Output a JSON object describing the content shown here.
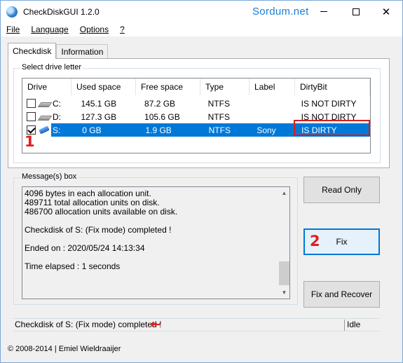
{
  "window": {
    "title": "CheckDiskGUI 1.2.0",
    "watermark": "Sordum.net",
    "close_glyph": "✕"
  },
  "menu": {
    "items": [
      "File",
      "Language",
      "Options",
      "?"
    ]
  },
  "tabs": [
    {
      "label": "Checkdisk",
      "active": true
    },
    {
      "label": "Information",
      "active": false
    }
  ],
  "drive_group": {
    "label": "Select drive letter",
    "columns": [
      "Drive",
      "Used space",
      "Free space",
      "Type",
      "Label",
      "DirtyBit"
    ],
    "rows": [
      {
        "checked": false,
        "icon": "hdd-icon",
        "drive": "C:",
        "used": "145.1 GB",
        "free": "87.2 GB",
        "type": "NTFS",
        "label": "",
        "dirty": "IS NOT DIRTY",
        "selected": false
      },
      {
        "checked": false,
        "icon": "hdd-icon",
        "drive": "D:",
        "used": "127.3 GB",
        "free": "105.6 GB",
        "type": "NTFS",
        "label": "",
        "dirty": "IS NOT DIRTY",
        "selected": false
      },
      {
        "checked": true,
        "icon": "usb-drive-icon",
        "drive": "S:",
        "used": "0 GB",
        "free": "1.9 GB",
        "type": "NTFS",
        "label": "Sony",
        "dirty": "IS DIRTY",
        "selected": true
      }
    ],
    "marker": "1"
  },
  "message_box": {
    "label": "Message(s) box",
    "lines": [
      "4096 bytes in each allocation unit.",
      "489711 total allocation units on disk.",
      "486700 allocation units available on disk.",
      "",
      "Checkdisk of S: (Fix mode) completed !",
      "",
      "Ended on : 2020/05/24 14:13:34",
      "",
      "Time elapsed : 1 seconds"
    ]
  },
  "buttons": {
    "read_only": "Read Only",
    "fix": "Fix",
    "fix_recover": "Fix and Recover",
    "marker": "2"
  },
  "status": {
    "message": "Checkdisk of S: (Fix mode) completed !",
    "state": "Idle",
    "arrow": "←"
  },
  "footer": {
    "copyright": "© 2008-2014 | Emiel Wieldraaijer"
  },
  "colors": {
    "selection": "#0078d7",
    "highlight_marker": "#e02020",
    "watermark": "#1a7fd4"
  }
}
